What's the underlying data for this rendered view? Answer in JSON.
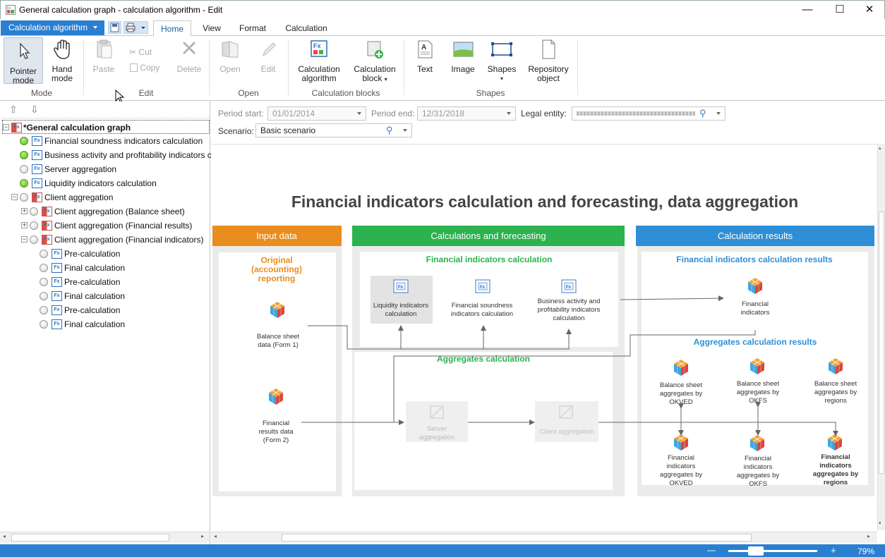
{
  "window": {
    "title": "General calculation graph - calculation algorithm - Edit",
    "min": "—",
    "max": "☐",
    "close": "✕"
  },
  "app_menu": {
    "label": "Calculation algorithm"
  },
  "tabs": [
    {
      "label": "Home"
    },
    {
      "label": "View"
    },
    {
      "label": "Format"
    },
    {
      "label": "Calculation"
    }
  ],
  "ribbon": {
    "pointer": "Pointer mode",
    "pointer_l1": "Pointer",
    "pointer_l2": "mode",
    "hand_l1": "Hand",
    "hand_l2": "mode",
    "paste": "Paste",
    "cut": "Cut",
    "copy": "Copy",
    "delete": "Delete",
    "open": "Open",
    "edit": "Edit",
    "calc_alg_l1": "Calculation",
    "calc_alg_l2": "algorithm",
    "calc_block_l1": "Calculation",
    "calc_block_l2": "block",
    "text": "Text",
    "image": "Image",
    "shapes": "Shapes",
    "repo_l1": "Repository",
    "repo_l2": "object",
    "groups": {
      "mode": "Mode",
      "edit": "Edit",
      "open": "Open",
      "calc_blocks": "Calculation blocks",
      "shapes": "Shapes"
    }
  },
  "tree": [
    {
      "label": "*General calculation graph"
    },
    {
      "label": "Financial soundness indicators calculation"
    },
    {
      "label": "Business activity and profitability indicators calcu"
    },
    {
      "label": "Server aggregation"
    },
    {
      "label": "Liquidity indicators calculation"
    },
    {
      "label": "Client aggregation"
    },
    {
      "label": "Client aggregation (Balance sheet)"
    },
    {
      "label": "Client aggregation (Financial results)"
    },
    {
      "label": "Client aggregation (Financial indicators)"
    },
    {
      "label": "Pre-calculation"
    },
    {
      "label": "Final calculation"
    },
    {
      "label": "Pre-calculation"
    },
    {
      "label": "Final calculation"
    },
    {
      "label": "Pre-calculation"
    },
    {
      "label": "Final calculation"
    }
  ],
  "filters": {
    "period_start_label": "Period start:",
    "period_start": "01/01/2014",
    "period_end_label": "Period end:",
    "period_end": "12/31/2018",
    "legal_entity_label": "Legal entity:",
    "scenario_label": "Scenario:",
    "scenario": "Basic scenario"
  },
  "diagram": {
    "title": "Financial indicators calculation and forecasting, data aggregation",
    "input_header": "Input data",
    "calc_header": "Calculations and forecasting",
    "results_header": "Calculation results",
    "orig_l1": "Original",
    "orig_l2": "(accounting)",
    "orig_l3": "reporting",
    "bs_l1": "Balance sheet",
    "bs_l2": "data (Form 1)",
    "fr_l1": "Financial",
    "fr_l2": "results data",
    "fr_l3": "(Form 2)",
    "fic_title": "Financial indicators calculation",
    "liq_l1": "Liquidity indicators",
    "liq_l2": "calculation",
    "fs_l1": "Financial soundness",
    "fs_l2": "indicators calculation",
    "ba_l1": "Business activity and",
    "ba_l2": "profitability indicators",
    "ba_l3": "calculation",
    "agg_title": "Aggregates calculation",
    "srv_l1": "Server",
    "srv_l2": "aggregation",
    "cli": "Client aggregation",
    "ficr_title": "Financial indicators calculation results",
    "fi_l1": "Financial",
    "fi_l2": "indicators",
    "acr_title": "Aggregates calculation results",
    "bso_l1": "Balance sheet",
    "bso_l2": "aggregates by",
    "bso_l3": "OKVED",
    "bsf_l1": "Balance sheet",
    "bsf_l2": "aggregates by",
    "bsf_l3": "OKFS",
    "bsr_l1": "Balance sheet",
    "bsr_l2": "aggregates by",
    "bsr_l3": "regions",
    "fio_l1": "Financial",
    "fio_l2": "indicators",
    "fio_l3": "aggregates by",
    "fio_l4": "OKVED",
    "fif_l1": "Financial",
    "fif_l2": "indicators",
    "fif_l3": "aggregates by",
    "fif_l4": "OKFS",
    "fir_l1": "Financial",
    "fir_l2": "indicators",
    "fir_l3": "aggregates by",
    "fir_l4": "regions"
  },
  "status": {
    "zoom_minus": "—",
    "zoom_plus": "+",
    "zoom": "79%"
  },
  "colors": {
    "accent": "#2b7fd0",
    "input": "#e98d1f",
    "calc": "#2cb24f",
    "results": "#2e8fd6"
  }
}
